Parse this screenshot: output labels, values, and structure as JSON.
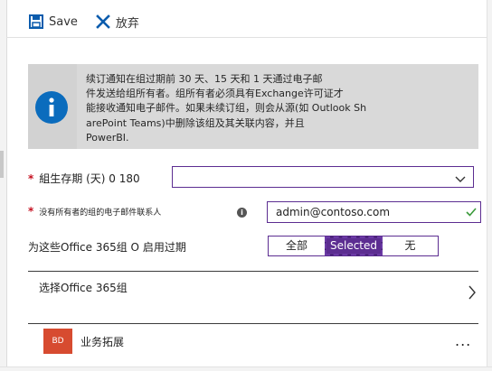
{
  "toolbar": {
    "save_label": "Save",
    "discard_label": "放弃"
  },
  "banner": {
    "lines": [
      "续订通知在组过期前 30 天、15 天和 1 天通过电子邮",
      "件发送给组所有者。组所有者必须具有Exchange许可证才",
      "能接收通知电子邮件。如果未续订组，则会从源(如 Outlook Sh",
      "arePoint Teams)中删除该组及其关联内容，并且",
      "PowerBI."
    ]
  },
  "form": {
    "lifetime": {
      "required_mark": "*",
      "label": "組生存期 (天) 0 180",
      "value": ""
    },
    "owner_email": {
      "required_mark": "*",
      "label": "没有所有者的组的电子邮件联系人",
      "value": "admin@contoso.com"
    },
    "expiration_scope": {
      "label": "为这些Office 365组 O 启用过期",
      "options": [
        "全部",
        "Selected",
        "无"
      ],
      "selected": "Selected"
    },
    "select_groups": {
      "label": "选择Office 365组"
    }
  },
  "groups": [
    {
      "initials": "BD",
      "name": "业务拓展",
      "more": "..."
    }
  ],
  "colors": {
    "accent": "#5c2d91",
    "toolbar_icon": "#0b5cad",
    "info_icon": "#0b6cbd",
    "avatar": "#d74b30",
    "required": "#c50f1f",
    "valid_check": "#3a9a3a"
  },
  "icons": {
    "save": "save-icon",
    "discard": "close-icon",
    "info": "info-icon",
    "dropdown": "chevron-down-icon",
    "valid": "checkmark-icon",
    "navigate": "chevron-right-icon"
  }
}
